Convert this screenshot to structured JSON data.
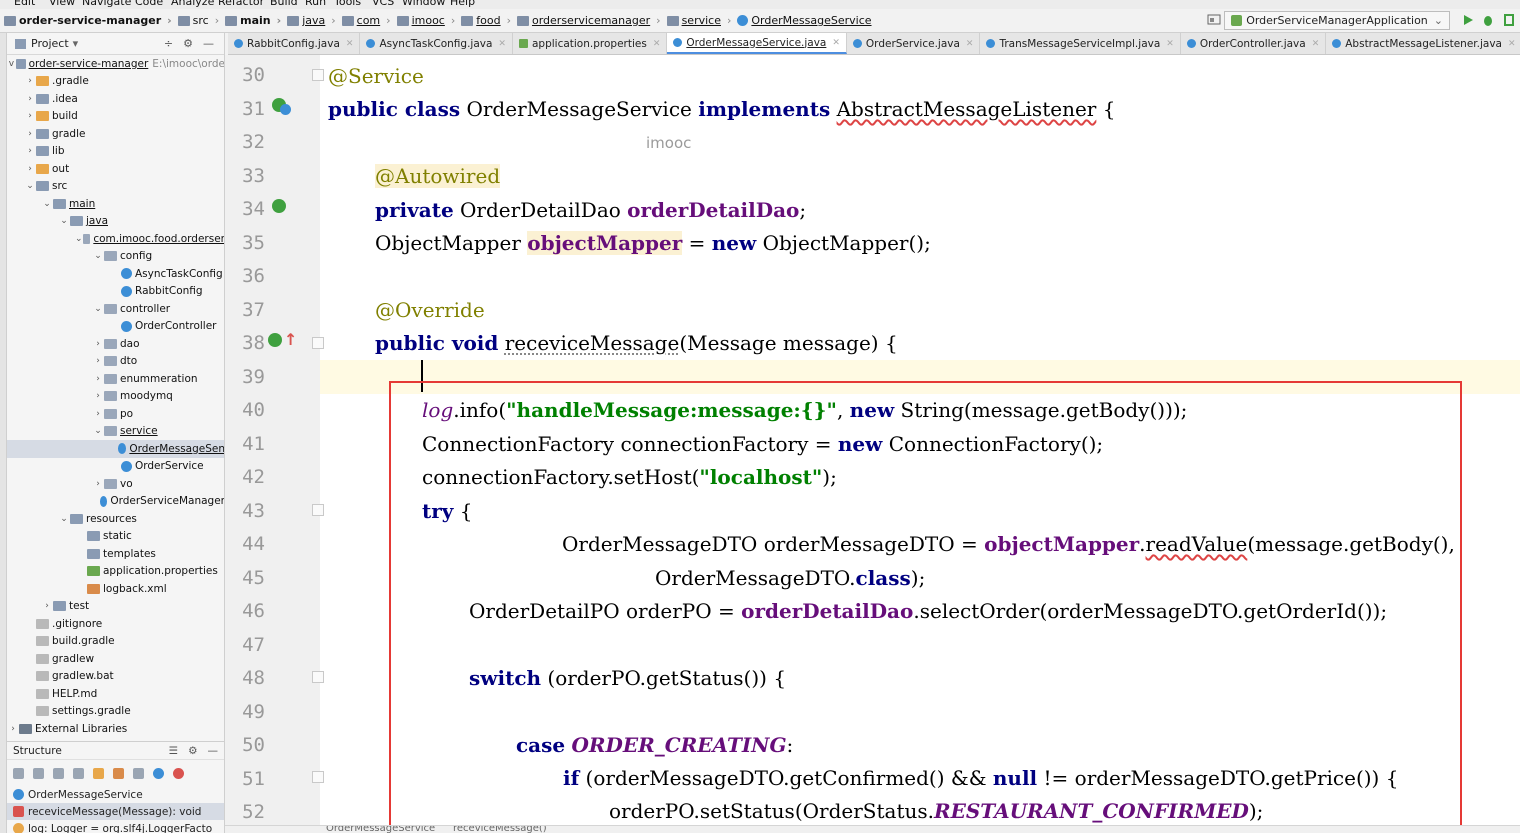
{
  "menubar": {
    "items": [
      "Edit",
      "View",
      "Navigate",
      "Code",
      "Analyze",
      "Refactor",
      "Build",
      "Run",
      "Tools",
      "VCS",
      "Window",
      "Help"
    ]
  },
  "navbar": {
    "crumbs": [
      "order-service-manager",
      "src",
      "main",
      "java",
      "com",
      "imooc",
      "food",
      "orderservicemanager",
      "service",
      "OrderMessageService"
    ],
    "run_config": "OrderServiceManagerApplication"
  },
  "tabs": [
    "RabbitConfig.java",
    "AsyncTaskConfig.java",
    "application.properties",
    "OrderMessageService.java",
    "OrderService.java",
    "TransMessageServiceImpl.java",
    "OrderController.java",
    "AbstractMessageListener.java"
  ],
  "project": {
    "title": "Project",
    "root": "order-service-manager",
    "root_path": "E:\\imooc\\orde",
    "items": [
      {
        "label": ".gradle",
        "depth": 1,
        "arrow": ">",
        "icon": "orange"
      },
      {
        "label": ".idea",
        "depth": 1,
        "arrow": ">",
        "icon": "folder"
      },
      {
        "label": "build",
        "depth": 1,
        "arrow": ">",
        "icon": "orange"
      },
      {
        "label": "gradle",
        "depth": 1,
        "arrow": ">",
        "icon": "folder"
      },
      {
        "label": "lib",
        "depth": 1,
        "arrow": ">",
        "icon": "folder"
      },
      {
        "label": "out",
        "depth": 1,
        "arrow": ">",
        "icon": "orange"
      },
      {
        "label": "src",
        "depth": 1,
        "arrow": "v",
        "icon": "folder"
      },
      {
        "label": "main",
        "depth": 2,
        "arrow": "v",
        "icon": "folder"
      },
      {
        "label": "java",
        "depth": 3,
        "arrow": "v",
        "icon": "folder"
      },
      {
        "label": "com.imooc.food.orderser",
        "depth": 4,
        "arrow": "v",
        "icon": "pkg"
      },
      {
        "label": "config",
        "depth": 5,
        "arrow": "v",
        "icon": "pkg"
      },
      {
        "label": "AsyncTaskConfig",
        "depth": 6,
        "arrow": "",
        "icon": "cls"
      },
      {
        "label": "RabbitConfig",
        "depth": 6,
        "arrow": "",
        "icon": "cls"
      },
      {
        "label": "controller",
        "depth": 5,
        "arrow": "v",
        "icon": "pkg"
      },
      {
        "label": "OrderController",
        "depth": 6,
        "arrow": "",
        "icon": "cls"
      },
      {
        "label": "dao",
        "depth": 5,
        "arrow": ">",
        "icon": "pkg"
      },
      {
        "label": "dto",
        "depth": 5,
        "arrow": ">",
        "icon": "pkg"
      },
      {
        "label": "enummeration",
        "depth": 5,
        "arrow": ">",
        "icon": "pkg"
      },
      {
        "label": "moodymq",
        "depth": 5,
        "arrow": ">",
        "icon": "pkg"
      },
      {
        "label": "po",
        "depth": 5,
        "arrow": ">",
        "icon": "pkg"
      },
      {
        "label": "service",
        "depth": 5,
        "arrow": "v",
        "icon": "pkg"
      },
      {
        "label": "OrderMessageSen",
        "depth": 6,
        "arrow": "",
        "icon": "cls",
        "selected": true
      },
      {
        "label": "OrderService",
        "depth": 6,
        "arrow": "",
        "icon": "cls"
      },
      {
        "label": "vo",
        "depth": 5,
        "arrow": ">",
        "icon": "pkg"
      },
      {
        "label": "OrderServiceManager",
        "depth": 5,
        "arrow": "",
        "icon": "cls"
      },
      {
        "label": "resources",
        "depth": 3,
        "arrow": "v",
        "icon": "folder"
      },
      {
        "label": "static",
        "depth": 4,
        "arrow": "",
        "icon": "folder"
      },
      {
        "label": "templates",
        "depth": 4,
        "arrow": "",
        "icon": "folder"
      },
      {
        "label": "application.properties",
        "depth": 4,
        "arrow": "",
        "icon": "prop"
      },
      {
        "label": "logback.xml",
        "depth": 4,
        "arrow": "",
        "icon": "xml"
      },
      {
        "label": "test",
        "depth": 2,
        "arrow": ">",
        "icon": "folder"
      },
      {
        "label": ".gitignore",
        "depth": 1,
        "arrow": "",
        "icon": "file"
      },
      {
        "label": "build.gradle",
        "depth": 1,
        "arrow": "",
        "icon": "file"
      },
      {
        "label": "gradlew",
        "depth": 1,
        "arrow": "",
        "icon": "file"
      },
      {
        "label": "gradlew.bat",
        "depth": 1,
        "arrow": "",
        "icon": "file"
      },
      {
        "label": "HELP.md",
        "depth": 1,
        "arrow": "",
        "icon": "file"
      },
      {
        "label": "settings.gradle",
        "depth": 1,
        "arrow": "",
        "icon": "file"
      },
      {
        "label": "External Libraries",
        "depth": 0,
        "arrow": ">",
        "icon": "lib"
      }
    ]
  },
  "structure": {
    "title": "Structure",
    "rows": [
      {
        "label": "OrderMessageService",
        "icon": "cls"
      },
      {
        "label": "receviceMessage(Message): void",
        "icon": "m",
        "selected": true
      },
      {
        "label": "log: Logger = org.slf4j.LoggerFacto",
        "icon": "f"
      }
    ]
  },
  "editor": {
    "watermark": "imooc",
    "line_numbers": [
      "30",
      "31",
      "32",
      "33",
      "34",
      "35",
      "36",
      "37",
      "38",
      "39",
      "40",
      "41",
      "42",
      "43",
      "44",
      "45",
      "46",
      "47",
      "48",
      "49",
      "50",
      "51",
      "52"
    ],
    "breadcrumb": [
      "OrderMessageService",
      "receviceMessage()"
    ]
  }
}
